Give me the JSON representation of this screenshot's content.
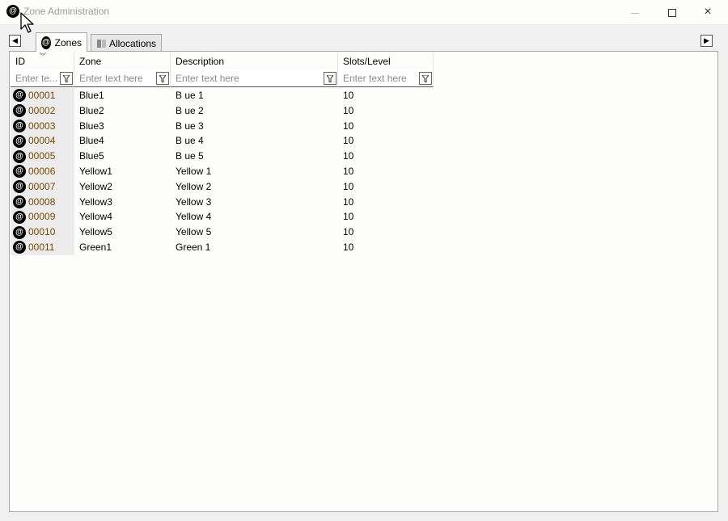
{
  "window": {
    "title": "Zone Administration",
    "icon": "at-sign-icon",
    "controls": {
      "minimize": "minimize-icon",
      "maximize": "maximize-icon",
      "close": "×"
    }
  },
  "tabs": [
    {
      "label": "Zones",
      "icon": "at-sign-icon",
      "active": true
    },
    {
      "label": "Allocations",
      "icon": "book-icon",
      "active": false
    }
  ],
  "nav": {
    "left": "◀",
    "right": "▶"
  },
  "grid": {
    "columns": [
      {
        "label": "ID",
        "filter_placeholder": "Enter te..."
      },
      {
        "label": "Zone",
        "filter_placeholder": "Enter text here"
      },
      {
        "label": "Description",
        "filter_placeholder": "Enter text here"
      },
      {
        "label": "Slots/Level",
        "filter_placeholder": "Enter text here"
      }
    ],
    "sort_glyph": "︾",
    "rows": [
      {
        "id": "00001",
        "zone": "Blue1",
        "description": "B ue 1",
        "slots": "10"
      },
      {
        "id": "00002",
        "zone": "Blue2",
        "description": "B ue 2",
        "slots": "10"
      },
      {
        "id": "00003",
        "zone": "Blue3",
        "description": "B ue 3",
        "slots": "10"
      },
      {
        "id": "00004",
        "zone": "Blue4",
        "description": "B ue 4",
        "slots": "10"
      },
      {
        "id": "00005",
        "zone": "Blue5",
        "description": "B ue 5",
        "slots": "10"
      },
      {
        "id": "00006",
        "zone": "Yellow1",
        "description": "Yellow 1",
        "slots": "10"
      },
      {
        "id": "00007",
        "zone": "Yellow2",
        "description": "Yellow 2",
        "slots": "10"
      },
      {
        "id": "00008",
        "zone": "Yellow3",
        "description": "Yellow 3",
        "slots": "10"
      },
      {
        "id": "00009",
        "zone": "Yellow4",
        "description": "Yellow 4",
        "slots": "10"
      },
      {
        "id": "00010",
        "zone": "Yellow5",
        "description": "Yellow 5",
        "slots": "10"
      },
      {
        "id": "00011",
        "zone": "Green1",
        "description": "Green 1",
        "slots": "10"
      }
    ],
    "row_icon_glyph": "@"
  },
  "colors": {
    "id_text": "#7a4a00",
    "window_bg": "#f0f0f0",
    "panel_bg": "#fdfdfb"
  }
}
